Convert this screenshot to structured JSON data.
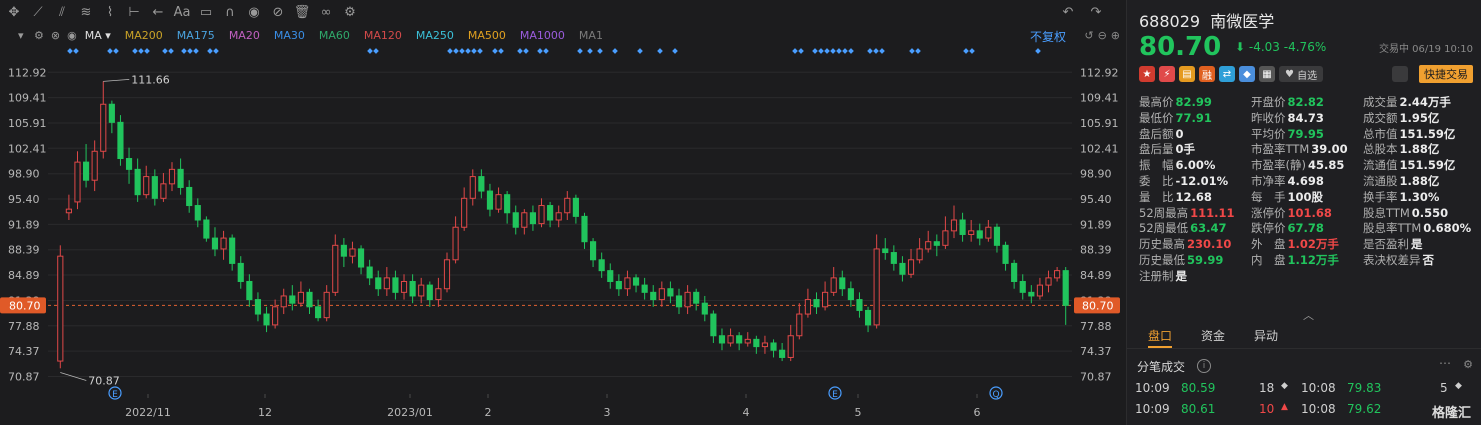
{
  "toolbar": {
    "icons": [
      "crosshair-icon",
      "line-tool-icon",
      "channel-tool-icon",
      "fibonacci-icon",
      "pattern-icon",
      "measure-icon",
      "arrow-left-icon",
      "text-icon",
      "comment-icon",
      "magnet-icon",
      "eye-icon",
      "hide-icon",
      "trash-icon",
      "link-icon",
      "settings-icon"
    ],
    "right_icons": [
      "undo-icon",
      "redo-icon"
    ]
  },
  "ma_bar": {
    "label": "MA",
    "items": [
      {
        "name": "MA200",
        "color": "#c9a227"
      },
      {
        "name": "MA175",
        "color": "#4aa3df"
      },
      {
        "name": "MA20",
        "color": "#c060c0"
      },
      {
        "name": "MA30",
        "color": "#3a8ee6"
      },
      {
        "name": "MA60",
        "color": "#2fa86a"
      },
      {
        "name": "MA120",
        "color": "#d24a4a"
      },
      {
        "name": "MA250",
        "color": "#3bc0d8"
      },
      {
        "name": "MA500",
        "color": "#e0a020"
      },
      {
        "name": "MA1000",
        "color": "#9a5cdc"
      },
      {
        "name": "MA1",
        "color": "#7a7a7a"
      }
    ],
    "fuquan": "不复权"
  },
  "chart_data": {
    "type": "candlestick",
    "y_ticks": [
      "112.92",
      "109.41",
      "105.91",
      "102.41",
      "98.90",
      "95.40",
      "91.89",
      "88.39",
      "84.89",
      "81.38",
      "77.88",
      "74.37",
      "70.87"
    ],
    "x_ticks": [
      "2022/11",
      "12",
      "2023/01",
      "2",
      "3",
      "4",
      "5",
      "6"
    ],
    "ylim": [
      69.0,
      116.0
    ],
    "last_price": "80.70",
    "high_marker": "111.66",
    "low_marker": "70.87",
    "event_markers": [
      "E",
      "E",
      "Q"
    ],
    "candles": [
      [
        73.0,
        87.5,
        72.0,
        89.0
      ],
      [
        93.5,
        94.0,
        92.5,
        96.0
      ],
      [
        95.0,
        100.5,
        94.0,
        102.0
      ],
      [
        100.5,
        98.0,
        97.0,
        103.0
      ],
      [
        98.0,
        102.0,
        96.5,
        103.5
      ],
      [
        102.0,
        108.5,
        101.0,
        111.66
      ],
      [
        108.5,
        106.0,
        104.5,
        109.0
      ],
      [
        106.0,
        101.0,
        100.0,
        107.0
      ],
      [
        101.0,
        99.5,
        97.5,
        102.5
      ],
      [
        99.5,
        96.0,
        95.0,
        101.0
      ],
      [
        96.0,
        98.5,
        95.5,
        100.0
      ],
      [
        98.5,
        95.5,
        94.5,
        99.5
      ],
      [
        95.5,
        97.5,
        95.0,
        99.0
      ],
      [
        97.5,
        99.5,
        96.5,
        100.5
      ],
      [
        99.5,
        97.0,
        96.0,
        101.0
      ],
      [
        97.0,
        94.5,
        93.5,
        98.0
      ],
      [
        94.5,
        92.5,
        91.5,
        95.5
      ],
      [
        92.5,
        90.0,
        89.5,
        93.0
      ],
      [
        90.0,
        88.5,
        87.5,
        91.5
      ],
      [
        88.5,
        90.0,
        87.0,
        91.0
      ],
      [
        90.0,
        86.5,
        85.5,
        90.5
      ],
      [
        86.5,
        84.0,
        83.0,
        87.5
      ],
      [
        84.0,
        81.5,
        80.5,
        85.0
      ],
      [
        81.5,
        79.5,
        78.5,
        82.5
      ],
      [
        79.5,
        78.0,
        77.0,
        80.5
      ],
      [
        78.0,
        80.5,
        77.5,
        81.5
      ],
      [
        80.5,
        82.0,
        79.5,
        83.0
      ],
      [
        82.0,
        81.0,
        80.0,
        83.5
      ],
      [
        81.0,
        82.5,
        80.5,
        84.0
      ],
      [
        82.5,
        80.5,
        79.5,
        83.0
      ],
      [
        80.5,
        79.0,
        78.5,
        81.5
      ],
      [
        79.0,
        82.5,
        78.5,
        83.5
      ],
      [
        82.5,
        89.0,
        82.0,
        90.5
      ],
      [
        89.0,
        87.5,
        86.0,
        90.0
      ],
      [
        87.5,
        88.5,
        86.5,
        89.5
      ],
      [
        88.5,
        86.0,
        85.0,
        89.0
      ],
      [
        86.0,
        84.5,
        83.5,
        87.0
      ],
      [
        84.5,
        83.0,
        82.0,
        85.5
      ],
      [
        83.0,
        84.5,
        82.0,
        86.0
      ],
      [
        84.5,
        82.5,
        81.5,
        85.5
      ],
      [
        82.5,
        84.0,
        81.5,
        85.0
      ],
      [
        84.0,
        82.0,
        81.0,
        85.0
      ],
      [
        82.0,
        83.5,
        81.0,
        84.5
      ],
      [
        83.5,
        81.5,
        80.5,
        84.0
      ],
      [
        81.5,
        83.0,
        80.5,
        84.5
      ],
      [
        83.0,
        87.0,
        82.5,
        88.0
      ],
      [
        87.0,
        91.5,
        86.5,
        93.0
      ],
      [
        91.5,
        95.5,
        91.0,
        97.0
      ],
      [
        95.5,
        98.5,
        94.5,
        99.5
      ],
      [
        98.5,
        96.5,
        95.5,
        99.5
      ],
      [
        96.5,
        94.0,
        93.0,
        97.5
      ],
      [
        94.0,
        96.0,
        93.5,
        97.0
      ],
      [
        96.0,
        93.5,
        92.0,
        96.5
      ],
      [
        93.5,
        91.5,
        90.5,
        94.5
      ],
      [
        91.5,
        93.5,
        90.5,
        94.0
      ],
      [
        93.5,
        92.0,
        91.0,
        94.5
      ],
      [
        92.0,
        94.5,
        91.5,
        95.5
      ],
      [
        94.5,
        92.5,
        91.5,
        95.0
      ],
      [
        92.5,
        93.5,
        91.5,
        94.5
      ],
      [
        93.5,
        95.5,
        92.5,
        96.5
      ],
      [
        95.5,
        93.0,
        92.0,
        96.0
      ],
      [
        93.0,
        89.5,
        88.5,
        93.5
      ],
      [
        89.5,
        87.0,
        86.0,
        90.0
      ],
      [
        87.0,
        85.5,
        84.5,
        88.0
      ],
      [
        85.5,
        84.0,
        83.0,
        86.5
      ],
      [
        84.0,
        83.0,
        82.0,
        85.0
      ],
      [
        83.0,
        84.5,
        82.0,
        85.5
      ],
      [
        84.5,
        83.5,
        82.5,
        85.0
      ],
      [
        83.5,
        82.5,
        81.5,
        84.5
      ],
      [
        82.5,
        81.5,
        80.5,
        83.5
      ],
      [
        81.5,
        83.0,
        80.5,
        84.0
      ],
      [
        83.0,
        82.0,
        81.0,
        84.0
      ],
      [
        82.0,
        80.5,
        79.5,
        83.0
      ],
      [
        80.5,
        82.5,
        79.5,
        83.5
      ],
      [
        82.5,
        81.0,
        80.0,
        83.0
      ],
      [
        81.0,
        79.5,
        78.5,
        82.0
      ],
      [
        79.5,
        76.5,
        75.5,
        80.0
      ],
      [
        76.5,
        75.5,
        74.5,
        77.5
      ],
      [
        75.5,
        76.5,
        75.0,
        77.5
      ],
      [
        76.5,
        75.5,
        74.5,
        77.0
      ],
      [
        75.5,
        76.0,
        75.0,
        77.0
      ],
      [
        76.0,
        75.0,
        74.0,
        76.5
      ],
      [
        75.0,
        75.5,
        74.0,
        76.5
      ],
      [
        75.5,
        74.5,
        73.5,
        76.0
      ],
      [
        74.5,
        73.5,
        73.0,
        75.5
      ],
      [
        73.5,
        76.5,
        73.0,
        78.0
      ],
      [
        76.5,
        79.5,
        76.0,
        81.0
      ],
      [
        79.5,
        81.5,
        79.0,
        83.0
      ],
      [
        81.5,
        80.5,
        79.5,
        82.5
      ],
      [
        80.5,
        82.5,
        80.0,
        84.0
      ],
      [
        82.5,
        84.5,
        82.0,
        86.0
      ],
      [
        84.5,
        83.0,
        82.0,
        85.5
      ],
      [
        83.0,
        81.5,
        80.5,
        84.0
      ],
      [
        81.5,
        80.0,
        79.0,
        82.5
      ],
      [
        80.0,
        78.0,
        77.0,
        80.5
      ],
      [
        78.0,
        88.5,
        77.5,
        90.5
      ],
      [
        88.5,
        88.0,
        87.0,
        90.0
      ],
      [
        88.0,
        86.5,
        85.5,
        89.0
      ],
      [
        86.5,
        85.0,
        84.0,
        87.5
      ],
      [
        85.0,
        87.0,
        84.5,
        88.5
      ],
      [
        87.0,
        88.5,
        86.5,
        90.0
      ],
      [
        88.5,
        89.5,
        88.0,
        91.0
      ],
      [
        89.5,
        89.0,
        87.5,
        90.5
      ],
      [
        89.0,
        91.0,
        88.5,
        93.0
      ],
      [
        91.0,
        92.5,
        90.0,
        94.5
      ],
      [
        92.5,
        90.5,
        89.5,
        93.5
      ],
      [
        90.5,
        91.0,
        89.5,
        92.5
      ],
      [
        91.0,
        90.0,
        89.0,
        92.0
      ],
      [
        90.0,
        91.5,
        89.5,
        92.5
      ],
      [
        91.5,
        89.0,
        88.0,
        92.0
      ],
      [
        89.0,
        86.5,
        85.5,
        89.5
      ],
      [
        86.5,
        84.0,
        83.0,
        87.0
      ],
      [
        84.0,
        82.5,
        81.5,
        85.0
      ],
      [
        82.5,
        82.0,
        81.0,
        83.5
      ],
      [
        82.0,
        83.5,
        81.5,
        84.5
      ],
      [
        83.5,
        84.5,
        82.5,
        85.5
      ],
      [
        84.5,
        85.5,
        84.0,
        86.0
      ],
      [
        85.5,
        80.7,
        78.0,
        86.0
      ]
    ]
  },
  "quote": {
    "code": "688029",
    "name": "南微医学",
    "price": "80.70",
    "arrow": "⬇",
    "change": "-4.03",
    "change_pct": "-4.76%",
    "trade_time": "交易中 06/19 10:10",
    "fav_label": "自选",
    "quick_trade": "快捷交易"
  },
  "stats": [
    [
      {
        "label": "最高价",
        "value": "82.99",
        "color": "g"
      },
      {
        "label": "开盘价",
        "value": "82.82",
        "color": "g"
      },
      {
        "label": "成交量",
        "value": "2.44万手",
        "color": ""
      }
    ],
    [
      {
        "label": "最低价",
        "value": "77.91",
        "color": "g"
      },
      {
        "label": "昨收价",
        "value": "84.73",
        "color": ""
      },
      {
        "label": "成交额",
        "value": "1.95亿",
        "color": ""
      }
    ],
    [
      {
        "label": "盘后额",
        "value": "0",
        "color": ""
      },
      {
        "label": "平均价",
        "value": "79.95",
        "color": "g"
      },
      {
        "label": "总市值",
        "value": "151.59亿",
        "color": ""
      }
    ],
    [
      {
        "label": "盘后量",
        "value": "0手",
        "color": ""
      },
      {
        "label": "市盈率TTM",
        "value": "39.00",
        "color": ""
      },
      {
        "label": "总股本",
        "value": "1.88亿",
        "color": ""
      }
    ],
    [
      {
        "label": "振　幅",
        "value": "6.00%",
        "color": ""
      },
      {
        "label": "市盈率(静)",
        "value": "45.85",
        "color": ""
      },
      {
        "label": "流通值",
        "value": "151.59亿",
        "color": ""
      }
    ],
    [
      {
        "label": "委　比",
        "value": "-12.01%",
        "color": ""
      },
      {
        "label": "市净率",
        "value": "4.698",
        "color": ""
      },
      {
        "label": "流通股",
        "value": "1.88亿",
        "color": ""
      }
    ],
    [
      {
        "label": "量　比",
        "value": "12.68",
        "color": ""
      },
      {
        "label": "每　手",
        "value": "100股",
        "color": ""
      },
      {
        "label": "换手率",
        "value": "1.30%",
        "color": ""
      }
    ],
    [
      {
        "label": "52周最高",
        "value": "111.11",
        "color": "r"
      },
      {
        "label": "涨停价",
        "value": "101.68",
        "color": "r"
      },
      {
        "label": "股息TTM",
        "value": "0.550",
        "color": ""
      }
    ],
    [
      {
        "label": "52周最低",
        "value": "63.47",
        "color": "g"
      },
      {
        "label": "跌停价",
        "value": "67.78",
        "color": "g"
      },
      {
        "label": "股息率TTM",
        "value": "0.680%",
        "color": ""
      }
    ],
    [
      {
        "label": "历史最高",
        "value": "230.10",
        "color": "r"
      },
      {
        "label": "外　盘",
        "value": "1.02万手",
        "color": "r"
      },
      {
        "label": "是否盈利",
        "value": "是",
        "color": ""
      }
    ],
    [
      {
        "label": "历史最低",
        "value": "59.99",
        "color": "g"
      },
      {
        "label": "内　盘",
        "value": "1.12万手",
        "color": "g"
      },
      {
        "label": "表决权差异",
        "value": "否",
        "color": ""
      }
    ],
    [
      {
        "label": "注册制",
        "value": "是",
        "color": ""
      }
    ]
  ],
  "tabs": [
    "盘口",
    "资金",
    "异动"
  ],
  "fenbi": {
    "title": "分笔成交",
    "rows": [
      {
        "t1": "10:09",
        "p1": "80.59",
        "p1c": "g",
        "v1": "18",
        "d1": "◆",
        "d1c": "#cfcfcf",
        "t2": "10:08",
        "p2": "79.83",
        "p2c": "g",
        "v2": "5",
        "d2": "◆",
        "d2c": "#cfcfcf"
      },
      {
        "t1": "10:09",
        "p1": "80.61",
        "p1c": "g",
        "v1": "10",
        "v1c": "r",
        "d1": "▲",
        "d1c": "#f04848",
        "t2": "10:08",
        "p2": "79.62",
        "p2c": "g",
        "v2": "",
        "d2": "",
        "d2c": "#cfcfcf"
      }
    ]
  },
  "watermark": "格隆汇"
}
